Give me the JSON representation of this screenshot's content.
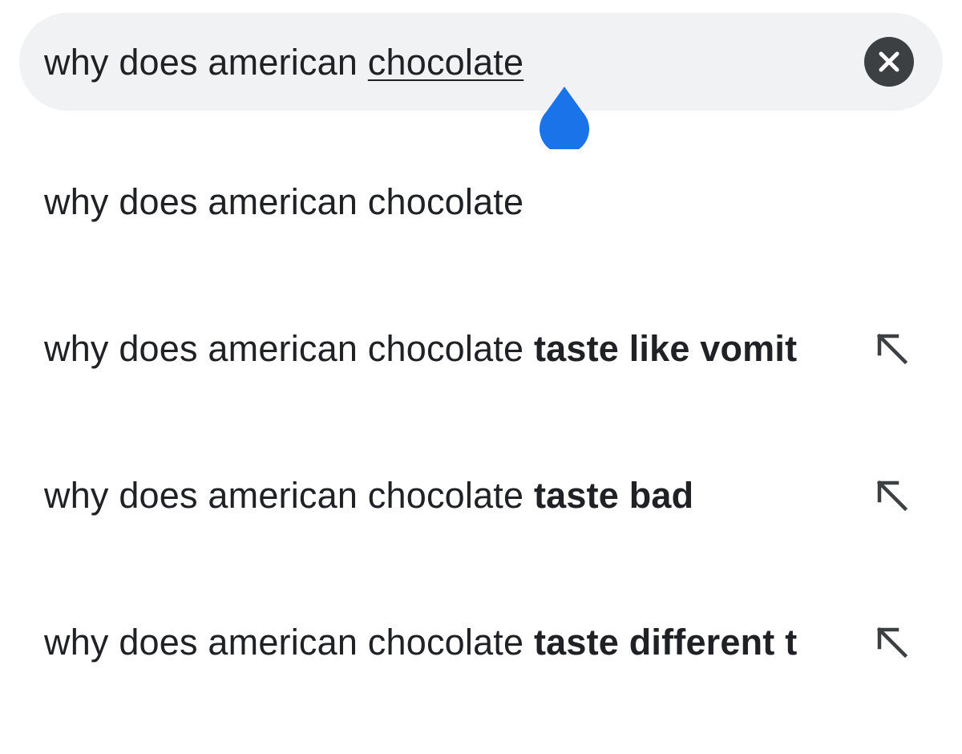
{
  "search": {
    "query_prefix": "why does american ",
    "query_underlined": "chocolate"
  },
  "icons": {
    "clear": "close-icon",
    "caret": "text-cursor-handle-icon",
    "fill": "arrow-up-left-icon"
  },
  "colors": {
    "search_bg": "#f1f2f4",
    "clear_bg": "#3c4043",
    "caret": "#1a73e8",
    "text": "#202124"
  },
  "suggestions": [
    {
      "prefix": "why does american chocolate",
      "completion": ""
    },
    {
      "prefix": "why does american chocolate ",
      "completion": "taste like vomit"
    },
    {
      "prefix": "why does american chocolate ",
      "completion": "taste bad"
    },
    {
      "prefix": "why does american chocolate ",
      "completion": "taste different t"
    }
  ]
}
